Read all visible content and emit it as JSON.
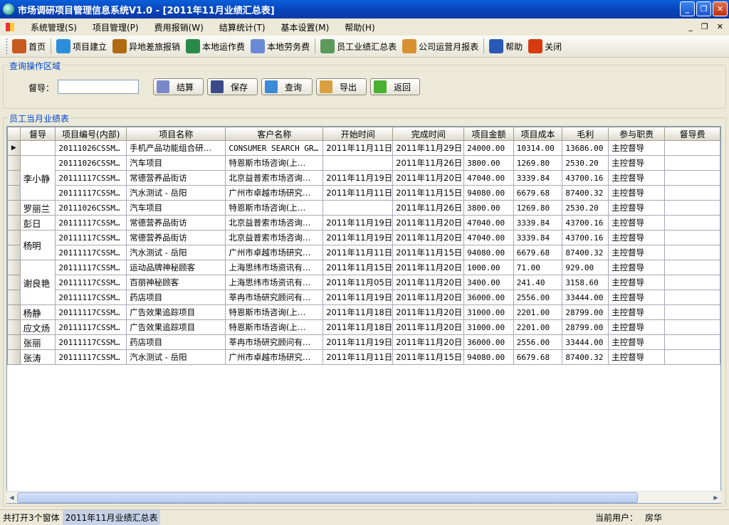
{
  "window": {
    "title": "市场调研项目管理信息系统V1.0 - [2011年11月业绩汇总表]"
  },
  "menu": [
    "系统管理(S)",
    "项目管理(P)",
    "费用报销(W)",
    "结算统计(T)",
    "基本设置(M)",
    "帮助(H)"
  ],
  "toolbar": [
    {
      "label": "首页",
      "icon": "home-icon",
      "color": "#c85a20"
    },
    {
      "label": "项目建立",
      "icon": "globe-icon",
      "color": "#2a8fd8"
    },
    {
      "label": "异地差旅报销",
      "icon": "briefcase-icon",
      "color": "#b06a10"
    },
    {
      "label": "本地运作费",
      "icon": "phone-globe-icon",
      "color": "#2a8a4a"
    },
    {
      "label": "本地劳务费",
      "icon": "scanner-icon",
      "color": "#6a8ad8"
    },
    {
      "label": "员工业绩汇总表",
      "icon": "excel-icon",
      "color": "#5a9a5a"
    },
    {
      "label": "公司运营月报表",
      "icon": "report-icon",
      "color": "#d89030"
    },
    {
      "label": "帮助",
      "icon": "help-icon",
      "color": "#2a5ab8"
    },
    {
      "label": "关闭",
      "icon": "power-icon",
      "color": "#d83a10"
    }
  ],
  "query": {
    "legend": "查询操作区域",
    "supervisor_label": "督导：",
    "supervisor_value": "",
    "buttons": [
      {
        "label": "结算",
        "icon": "settle-icon"
      },
      {
        "label": "保存",
        "icon": "floppy-icon"
      },
      {
        "label": "查询",
        "icon": "magnifier-icon"
      },
      {
        "label": "导出",
        "icon": "export-icon"
      },
      {
        "label": "返回",
        "icon": "arrow-right-icon"
      }
    ]
  },
  "grid": {
    "legend": "员工当月业绩表",
    "columns": [
      "督导",
      "项目编号(内部)",
      "项目名称",
      "客户名称",
      "开始时间",
      "完成时间",
      "项目金额",
      "项目成本",
      "毛利",
      "参与职责",
      "督导费"
    ],
    "groups": [
      {
        "supervisor": "",
        "rows": [
          [
            "20111026CSSM…",
            "手机产品功能组合研…",
            "CONSUMER SEARCH GR…",
            "2011年11月11日",
            "2011年11月29日",
            "24000.00",
            "10314.00",
            "13686.00",
            "主控督导",
            ""
          ]
        ]
      },
      {
        "supervisor": "李小静",
        "rows": [
          [
            "20111026CSSM…",
            "汽车项目",
            "特恩斯市场咨询(上…",
            "",
            "2011年11月26日",
            "3800.00",
            "1269.80",
            "2530.20",
            "主控督导",
            ""
          ],
          [
            "20111117CSSM…",
            "常德营养品街访",
            "北京益普索市场咨询…",
            "2011年11月19日",
            "2011年11月20日",
            "47040.00",
            "3339.84",
            "43700.16",
            "主控督导",
            ""
          ],
          [
            "20111117CSSM…",
            "汽水测试 - 岳阳",
            "广州市卓越市场研究…",
            "2011年11月11日",
            "2011年11月15日",
            "94080.00",
            "6679.68",
            "87400.32",
            "主控督导",
            ""
          ]
        ]
      },
      {
        "supervisor": "罗丽兰",
        "rows": [
          [
            "20111026CSSM…",
            "汽车项目",
            "特恩斯市场咨询(上…",
            "",
            "2011年11月26日",
            "3800.00",
            "1269.80",
            "2530.20",
            "主控督导",
            ""
          ]
        ]
      },
      {
        "supervisor": "彭日",
        "rows": [
          [
            "20111117CSSM…",
            "常德营养品街访",
            "北京益普索市场咨询…",
            "2011年11月19日",
            "2011年11月20日",
            "47040.00",
            "3339.84",
            "43700.16",
            "主控督导",
            ""
          ]
        ]
      },
      {
        "supervisor": "杨明",
        "rows": [
          [
            "20111117CSSM…",
            "常德营养品街访",
            "北京益普索市场咨询…",
            "2011年11月19日",
            "2011年11月20日",
            "47040.00",
            "3339.84",
            "43700.16",
            "主控督导",
            ""
          ],
          [
            "20111117CSSM…",
            "汽水测试 - 岳阳",
            "广州市卓越市场研究…",
            "2011年11月11日",
            "2011年11月15日",
            "94080.00",
            "6679.68",
            "87400.32",
            "主控督导",
            ""
          ]
        ]
      },
      {
        "supervisor": "谢良艳",
        "rows": [
          [
            "20111117CSSM…",
            "运动品牌神秘顾客",
            "上海思纬市场资讯有…",
            "2011年11月15日",
            "2011年11月20日",
            "1000.00",
            "71.00",
            "929.00",
            "主控督导",
            ""
          ],
          [
            "20111117CSSM…",
            "百丽神秘顾客",
            "上海思纬市场资讯有…",
            "2011年11月05日",
            "2011年11月20日",
            "3400.00",
            "241.40",
            "3158.60",
            "主控督导",
            ""
          ],
          [
            "20111117CSSM…",
            "药店项目",
            "莘冉市场研究顾问有…",
            "2011年11月19日",
            "2011年11月20日",
            "36000.00",
            "2556.00",
            "33444.00",
            "主控督导",
            ""
          ]
        ]
      },
      {
        "supervisor": "杨静",
        "rows": [
          [
            "20111117CSSM…",
            "广告效果追踪项目",
            "特恩斯市场咨询(上…",
            "2011年11月18日",
            "2011年11月20日",
            "31000.00",
            "2201.00",
            "28799.00",
            "主控督导",
            ""
          ]
        ]
      },
      {
        "supervisor": "应文炀",
        "rows": [
          [
            "20111117CSSM…",
            "广告效果追踪项目",
            "特恩斯市场咨询(上…",
            "2011年11月18日",
            "2011年11月20日",
            "31000.00",
            "2201.00",
            "28799.00",
            "主控督导",
            ""
          ]
        ]
      },
      {
        "supervisor": "张丽",
        "rows": [
          [
            "20111117CSSM…",
            "药店项目",
            "莘冉市场研究顾问有…",
            "2011年11月19日",
            "2011年11月20日",
            "36000.00",
            "2556.00",
            "33444.00",
            "主控督导",
            ""
          ]
        ]
      },
      {
        "supervisor": "张涛",
        "rows": [
          [
            "20111117CSSM…",
            "汽水测试 - 岳阳",
            "广州市卓越市场研究…",
            "2011年11月11日",
            "2011年11月15日",
            "94080.00",
            "6679.68",
            "87400.32",
            "主控督导",
            ""
          ]
        ]
      }
    ]
  },
  "status": {
    "open_windows": "共打开3个窗体",
    "active_window": "2011年11月业绩汇总表",
    "user_label": "当前用户：",
    "user_name": "房华"
  }
}
